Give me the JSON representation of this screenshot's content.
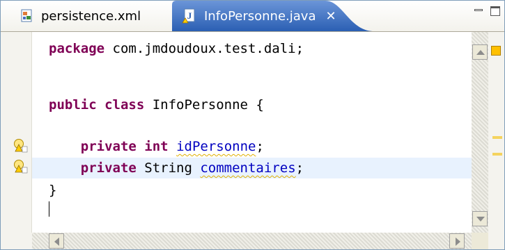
{
  "tabs": [
    {
      "label": "persistence.xml",
      "icon": "xml-file-icon",
      "active": false
    },
    {
      "label": "InfoPersonne.java",
      "icon": "java-file-warning-icon",
      "active": true,
      "close": "✕"
    }
  ],
  "code": {
    "lines": [
      {
        "kw": "package",
        "rest": " com.jmdoudoux.test.dali;"
      },
      {
        "kw": "public class",
        "rest": " InfoPersonne {"
      },
      {
        "indent": "    ",
        "kw": "private int",
        "sp": " ",
        "field": "idPersonne",
        "end": ";"
      },
      {
        "indent": "    ",
        "kw": "private",
        "rest": " String ",
        "field": "commentaires",
        "end": ";"
      },
      {
        "rest": "}"
      }
    ]
  },
  "markers": [
    "warning-light-icon",
    "warning-light-icon"
  ],
  "colors": {
    "keyword": "#7f0055",
    "field": "#0000c0",
    "tab_active": "#316ac5",
    "current_line": "#e8f2fe",
    "warning": "#ffc000"
  }
}
